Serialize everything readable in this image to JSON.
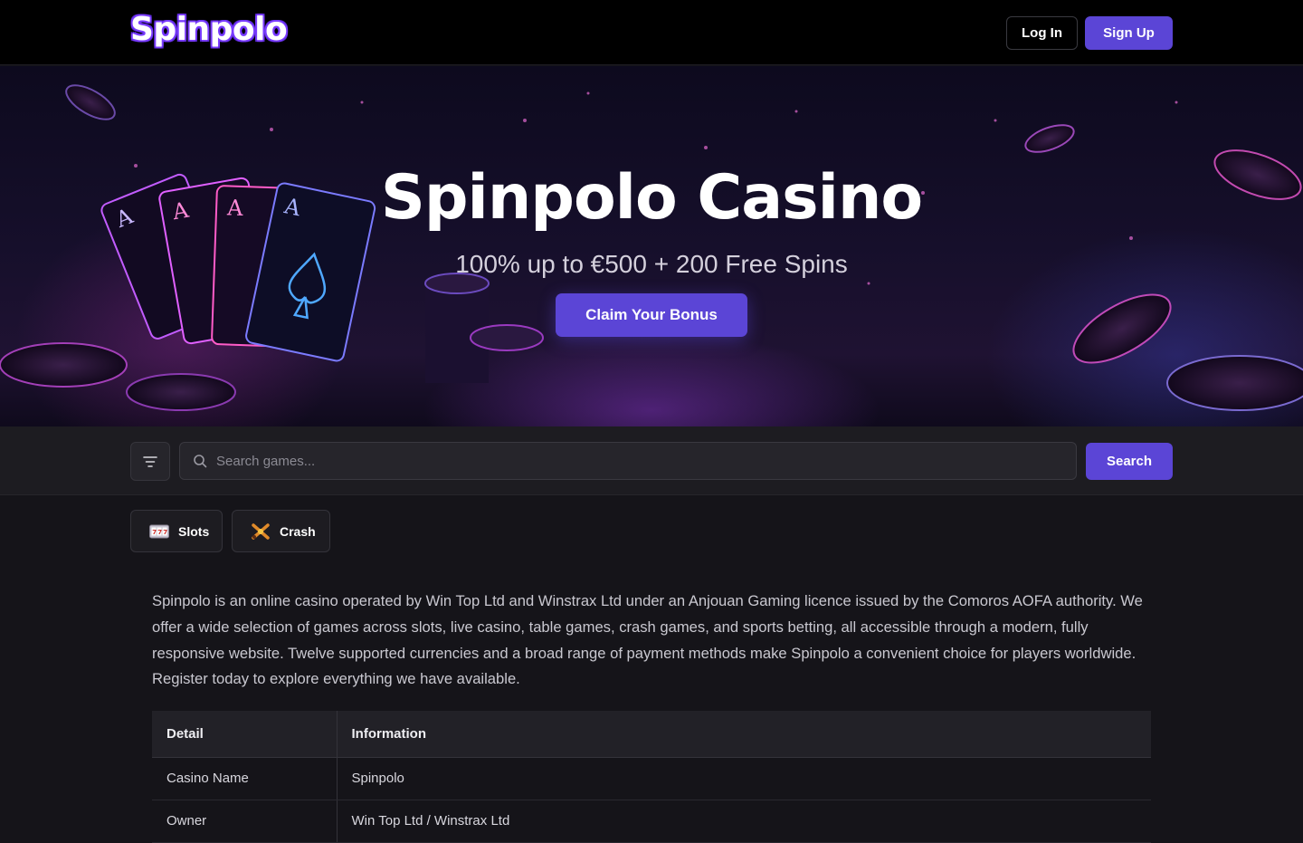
{
  "header": {
    "logo": "Spinpolo",
    "login_label": "Log In",
    "signup_label": "Sign Up"
  },
  "hero": {
    "title": "Spinpolo Casino",
    "subtitle": "100% up to €500 + 200 Free Spins",
    "cta_label": "Claim Your Bonus"
  },
  "search": {
    "placeholder": "Search games...",
    "button_label": "Search"
  },
  "categories": [
    {
      "label": "Slots",
      "icon": "slot-machine-icon"
    },
    {
      "label": "Crash",
      "icon": "crash-icon"
    }
  ],
  "intro": "Spinpolo is an online casino operated by Win Top Ltd and Winstrax Ltd under an Anjouan Gaming licence issued by the Comoros AOFA authority. We offer a wide selection of games across slots, live casino, table games, crash games, and sports betting, all accessible through a modern, fully responsive website. Twelve supported currencies and a broad range of payment methods make Spinpolo a convenient choice for players worldwide. Register today to explore everything we have available.",
  "table": {
    "headers": [
      "Detail",
      "Information"
    ],
    "rows": [
      [
        "Casino Name",
        "Spinpolo"
      ],
      [
        "Owner",
        "Win Top Ltd / Winstrax Ltd"
      ]
    ]
  },
  "colors": {
    "accent": "#5b45d6",
    "background": "#151419",
    "header_bg": "#000000"
  }
}
